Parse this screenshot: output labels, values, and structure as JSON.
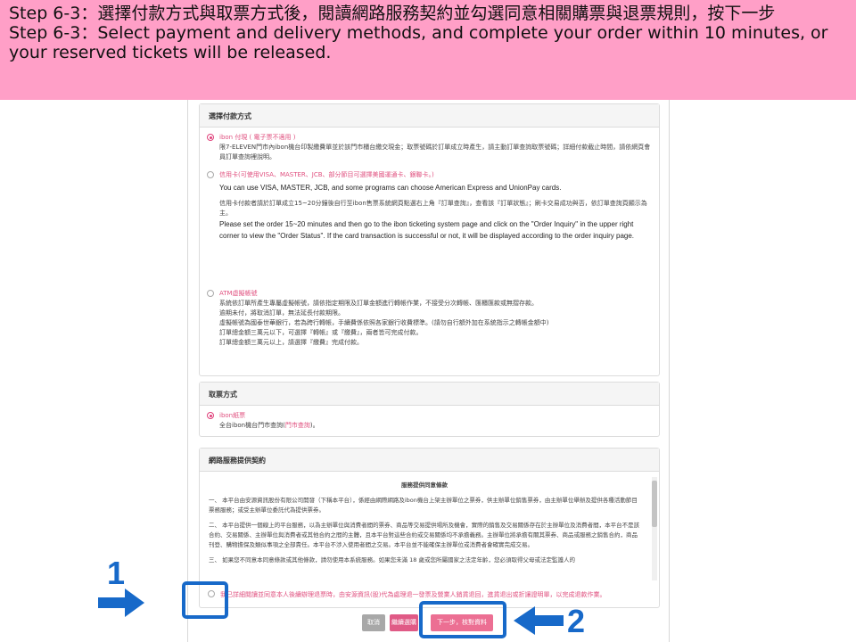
{
  "banner": {
    "line1_zh": "Step 6-3：選擇付款方式與取票方式後，閱讀網路服務契約並勾選同意相關購票與退票規則，按下一步",
    "line2_en": "Step 6-3：Select payment and delivery methods, and complete your order within 10 minutes, or your reserved tickets will be released."
  },
  "payment": {
    "header": "選擇付款方式",
    "ibon": {
      "title": "ibon 付現 ( 電子票不適用 )",
      "desc": "限7-ELEVEN門市內ibon機台印製繳費單並於該門市櫃台繳交現金；取票號碼於訂單成立時產生，請主動訂單查詢取票號碼；詳細付款截止時間，請依網頁會員訂單查詢裡說明。"
    },
    "card": {
      "title": "信用卡(可使用VISA、MASTER、JCB、部分節目可選擇美國運通卡、銀聯卡。)",
      "en1": "You can use VISA, MASTER, JCB, and some programs can choose American Express and UnionPay cards.",
      "zh2": "信用卡付款者請於訂單成立15~20分鐘後自行至ibon售票系統網頁點選右上角『訂單查詢』，查看該『訂單狀態』；刷卡交易成功與否，依訂單查詢頁顯示為主。",
      "en2": "Please set the order 15~20 minutes and then go to the ibon ticketing system page and click on the \"Order Inquiry\" in the upper right corner to view the \"Order Status\". If the card transaction is successful or not, it will be displayed according to the order inquiry page."
    },
    "atm": {
      "title": "ATM虛擬帳號",
      "lines": [
        "系統依訂單所產生專屬虛擬帳號，請依指定期限及訂單金額進行轉帳作業，不接受分次轉帳、匯櫃匯款或無摺存款。",
        "逾期未付，將取消訂單，無法延長付款期限。",
        "虛擬帳號為國泰世華銀行，若為跨行轉帳，手續費係依照各家銀行收費標準。(請勿自行額外加在系統指示之轉帳金額中)",
        "訂單總金額三萬元以下，可選擇『轉帳』或『繳費』，兩者皆可完成付款。",
        "訂單總金額三萬元以上，請選擇『繳費』完成付款。"
      ]
    }
  },
  "delivery": {
    "header": "取票方式",
    "option_title": "ibon紙票",
    "desc_prefix": "全台ibon機台門市查詢(",
    "desc_link": "門市查詢",
    "desc_suffix": ")。"
  },
  "contract": {
    "header": "網路服務提供契約",
    "title": "服務提供同意條款",
    "p1": "一、 本平台由安源資訊股份有限公司開發（下稱本平台），係經由網際網路及ibon機台上架主辦單位之票券，供主辦單位銷售票券，由主辦單位舉辦及提供各種活動節目票務服務；或受主辦單位委託代為提供票券。",
    "p2": "二、 本平台提供一個線上的平台服務，以為主辦單位與消費者間的票券、商品等交易提供場所及機會，實際的銷售及交易關係存在於主辦單位及消費者間，本平台不是該合約、交易關係、主辦單位與消費者或其他合約之間的主體，且本平台對這些合約或交易關係均不承擔義務。主辦單位將承擔有關其票券、商品或服務之銷售合約，商品刊登、購物擔保及類似事項之全部責任。本平台不涉入使用者間之交易。本平台並不能確保主辦單位或消費者會確實完成交易。",
    "p3": "三、 如果您不同意本同意條款或其他條款，請勿使用本系統服務。如果您未滿 18 歲或您所屬國家之法定年齡，您必須取得父母或法定監護人的"
  },
  "agree": {
    "text": "我已詳細閱讀並同意本人後續辦理退票時，由安源資訊(股)代為處理退一發票及營業人銷貨退回，進貨退出或折讓證明單，以完成退款作業。"
  },
  "buttons": {
    "cancel": "取消",
    "continue": "繼續選購",
    "next": "下一步，核對資料"
  },
  "annotations": {
    "step1": "1",
    "step2": "2"
  },
  "colors": {
    "banner_bg": "#ff9fc7",
    "accent_pink": "#e0507f",
    "annotation_blue": "#1769c9"
  }
}
